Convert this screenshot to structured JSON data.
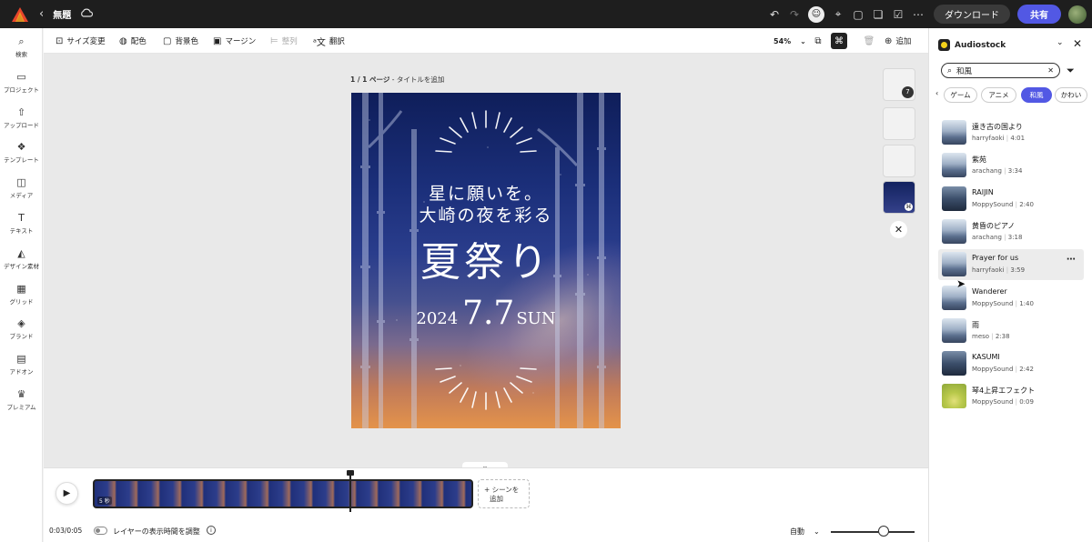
{
  "topbar": {
    "title": "無題",
    "download_label": "ダウンロード",
    "share_label": "共有",
    "icons": [
      "undo-icon",
      "redo-icon",
      "invite-icon",
      "pin-icon",
      "comment-icon",
      "chat-icon",
      "checklist-icon",
      "more-icon"
    ]
  },
  "rail": [
    {
      "label": "検索",
      "icon": "search-icon",
      "glyph": "⌕"
    },
    {
      "label": "プロジェクト",
      "icon": "folder-icon",
      "glyph": "▭"
    },
    {
      "label": "アップロード",
      "icon": "upload-icon",
      "glyph": "⇧"
    },
    {
      "label": "テンプレート",
      "icon": "template-icon",
      "glyph": "❖"
    },
    {
      "label": "メディア",
      "icon": "media-icon",
      "glyph": "◫"
    },
    {
      "label": "テキスト",
      "icon": "text-icon",
      "glyph": "T"
    },
    {
      "label": "デザイン素材",
      "icon": "shapes-icon",
      "glyph": "◭"
    },
    {
      "label": "グリッド",
      "icon": "grid-icon",
      "glyph": "▦"
    },
    {
      "label": "ブランド",
      "icon": "brand-icon",
      "glyph": "◈"
    },
    {
      "label": "アドオン",
      "icon": "addon-icon",
      "glyph": "▤"
    },
    {
      "label": "プレミアム",
      "icon": "crown-icon",
      "glyph": "♛"
    }
  ],
  "toolbar": {
    "resize": "サイズ変更",
    "color": "配色",
    "background": "背景色",
    "margin": "マージン",
    "arrange": "整列",
    "translate": "翻訳",
    "zoom": "54%",
    "add": "追加"
  },
  "canvas": {
    "page_label_bold": "1 / 1 ページ",
    "page_label_rest": " - タイトルを追加",
    "thumb_badge": "7"
  },
  "poster": {
    "line1": "星に願いを。",
    "line2": "大崎の夜を彩る",
    "headline": "夏祭り",
    "year": "2024",
    "monthday": "7.7",
    "weekday": "SUN"
  },
  "timeline": {
    "strip_label": "5 秒",
    "add_scene_line1": "+ シーンを",
    "add_scene_line2": "追加",
    "time": "0:03/0:05",
    "toggle_label": "レイヤーの表示時間を調整",
    "auto_label": "自動",
    "slider_level": 0.63
  },
  "panel": {
    "title": "Audiostock",
    "search_value": "和風",
    "chips": [
      "ゲーム",
      "アニメ",
      "和風",
      "かわい"
    ],
    "active_chip": "和風",
    "tracks": [
      {
        "name": "遠き古の国より",
        "artist": "harryfaoki",
        "duration": "4:01",
        "thumb": "light"
      },
      {
        "name": "紫苑",
        "artist": "arachang",
        "duration": "3:34",
        "thumb": "light"
      },
      {
        "name": "RAIJIN",
        "artist": "MoppySound",
        "duration": "2:40",
        "thumb": "dark"
      },
      {
        "name": "黄昏のピアノ",
        "artist": "arachang",
        "duration": "3:18",
        "thumb": "light"
      },
      {
        "name": "Prayer for us",
        "artist": "harryfaoki",
        "duration": "3:59",
        "thumb": "light"
      },
      {
        "name": "Wanderer",
        "artist": "MoppySound",
        "duration": "1:40",
        "thumb": "light"
      },
      {
        "name": "雨",
        "artist": "meso",
        "duration": "2:38",
        "thumb": "light"
      },
      {
        "name": "KASUMI",
        "artist": "MoppySound",
        "duration": "2:42",
        "thumb": "dark"
      },
      {
        "name": "琴4上昇エフェクト",
        "artist": "MoppySound",
        "duration": "0:09",
        "thumb": "green"
      }
    ],
    "hovered_track": 4
  },
  "colors": {
    "accent": "#5258e4",
    "topbar": "#1e1e1e"
  }
}
